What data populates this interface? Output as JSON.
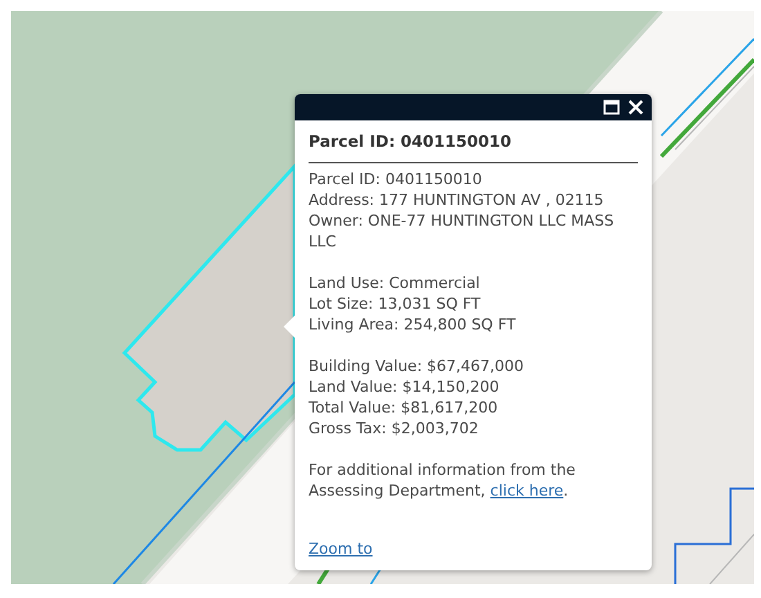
{
  "popup": {
    "title": "Parcel ID: 0401150010",
    "sections": [
      [
        "Parcel ID: 0401150010",
        "Address: 177 HUNTINGTON AV , 02115",
        "Owner: ONE-77 HUNTINGTON LLC MASS LLC"
      ],
      [
        "Land Use: Commercial",
        "Lot Size: 13,031 SQ FT",
        "Living Area: 254,800 SQ FT"
      ],
      [
        "Building Value: $67,467,000",
        "Land Value: $14,150,200",
        "Total Value: $81,617,200",
        "Gross Tax: $2,003,702"
      ]
    ],
    "info": {
      "text_before": "For additional information from the Assessing Department, ",
      "link": "click here",
      "text_after": "."
    },
    "zoom_link": "Zoom to"
  }
}
